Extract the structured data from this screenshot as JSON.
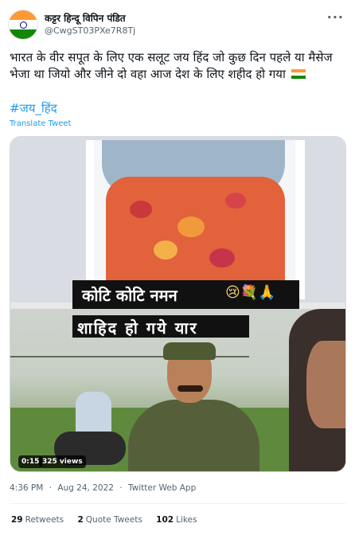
{
  "author": {
    "display_name": "कट्टर हिन्दू विपिन पंडित",
    "handle": "@CwgST03PXe7R8Tj",
    "more_icon": "ellipsis-icon"
  },
  "tweet": {
    "text": "भारत के वीर सपूत के लिए एक सलूट जय हिंद जो कुछ दिन पहले या मैसेज भेजा था जियो और जीने दो वहा आज देश के लिए शहीद हो गया",
    "flag_icon": "india-flag-emoji",
    "hashtag": "#जय_हिंद",
    "translate_label": "Translate Tweet"
  },
  "media": {
    "caption_top": "कोटि कोटि नमन",
    "caption_top_emojis": "😢💐🙏",
    "caption_bottom": "शाहिद हो गये यार",
    "duration": "0:15",
    "views": "325 views"
  },
  "meta": {
    "time": "4:36 PM",
    "date": "Aug 24, 2022",
    "source": "Twitter Web App",
    "separator": "·"
  },
  "stats": {
    "retweets_count": "29",
    "retweets_label": "Retweets",
    "quotes_count": "2",
    "quotes_label": "Quote Tweets",
    "likes_count": "102",
    "likes_label": "Likes"
  },
  "colors": {
    "link": "#1d9bf0",
    "secondary_text": "#536471",
    "primary_text": "#0f1419"
  }
}
